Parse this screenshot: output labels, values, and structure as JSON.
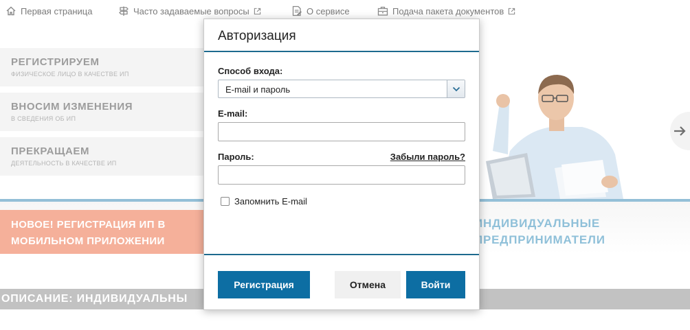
{
  "nav": {
    "items": [
      {
        "label": "Первая страница",
        "icon": "home-icon"
      },
      {
        "label": "Часто задаваемые вопросы",
        "icon": "signpost-icon"
      },
      {
        "label": "О сервисе",
        "icon": "document-icon"
      },
      {
        "label": "Подача пакета документов",
        "icon": "briefcase-icon"
      }
    ]
  },
  "menu": {
    "items": [
      {
        "title": "РЕГИСТРИРУЕМ",
        "subtitle": "ФИЗИЧЕСКОЕ ЛИЦО В КАЧЕСТВЕ ИП"
      },
      {
        "title": "ВНОСИМ ИЗМЕНЕНИЯ",
        "subtitle": "В СВЕДЕНИЯ ОБ ИП"
      },
      {
        "title": "ПРЕКРАЩАЕМ",
        "subtitle": "ДЕЯТЕЛЬНОСТЬ В КАЧЕСТВЕ ИП"
      }
    ]
  },
  "promo": {
    "line1": "НОВОЕ! РЕГИСТРАЦИЯ ИП В",
    "line2": "МОБИЛЬНОМ ПРИЛОЖЕНИИ"
  },
  "hero": {
    "line1": "ИНДИВИДУАЛЬНЫЕ",
    "line2": "ПРЕДПРИНИМАТЕЛИ"
  },
  "description": {
    "title": "ОПИСАНИЕ: ИНДИВИДУАЛЬНЫ"
  },
  "modal": {
    "title": "Авторизация",
    "login_method_label": "Способ входа:",
    "login_method_value": "E-mail и пароль",
    "email_label": "E-mail:",
    "email_value": "",
    "password_label": "Пароль:",
    "password_value": "",
    "forgot_link": "Забыли пароль?",
    "remember_label": "Запомнить E-mail",
    "remember_checked": false,
    "register_button": "Регистрация",
    "cancel_button": "Отмена",
    "login_button": "Войти"
  },
  "colors": {
    "accent": "#0d6ea3",
    "promo": "#f5b09a",
    "hero_text": "#8fc0d9",
    "description_bar": "#c2c2c2"
  }
}
